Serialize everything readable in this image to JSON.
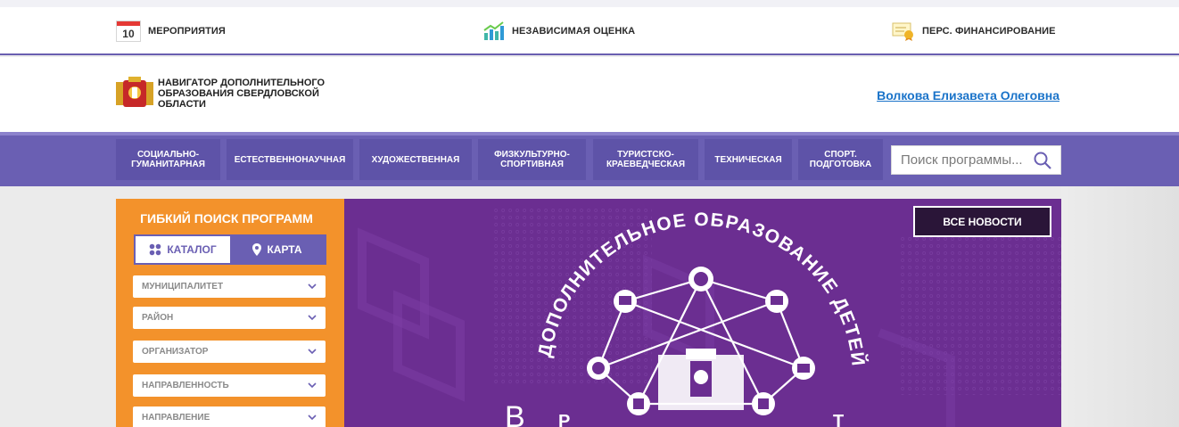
{
  "topbar": {
    "events_day": "10",
    "events_label": "МЕРОПРИЯТИЯ",
    "eval_label": "НЕЗАВИСИМАЯ ОЦЕНКА",
    "fin_label": "ПЕРС. ФИНАНСИРОВАНИЕ"
  },
  "header": {
    "brand": "НАВИГАТОР ДОПОЛНИТЕЛЬНОГО ОБРАЗОВАНИЯ СВЕРДЛОВСКОЙ ОБЛАСТИ",
    "user_name": "Волкова Елизавета Олеговна"
  },
  "nav": {
    "items": [
      "СОЦИАЛЬНО-ГУМАНИТАРНАЯ",
      "ЕСТЕСТВЕННОНАУЧНАЯ",
      "ХУДОЖЕСТВЕННАЯ",
      "ФИЗКУЛЬТУРНО-СПОРТИВНАЯ",
      "ТУРИСТСКО-КРАЕВЕДЧЕСКАЯ",
      "ТЕХНИЧЕСКАЯ",
      "СПОРТ. ПОДГОТОВКА"
    ],
    "search_placeholder": "Поиск программы..."
  },
  "filter": {
    "title": "ГИБКИЙ ПОИСК ПРОГРАММ",
    "mode_catalog": "КАТАЛОГ",
    "mode_map": "КАРТА",
    "selects": [
      "МУНИЦИПАЛИТЕТ",
      "РАЙОН",
      "ОРГАНИЗАТОР",
      "НАПРАВЛЕННОСТЬ",
      "НАПРАВЛЕНИЕ"
    ]
  },
  "banner": {
    "arc_text": "ДОПОЛНИТЕЛЬНОЕ ОБРАЗОВАНИЕ ДЕТЕЙ",
    "bottom_left_glyph": "Р",
    "bottom_right_glyph": "Т",
    "cut_text": "В",
    "news_button": "ВСЕ НОВОСТИ"
  },
  "colors": {
    "brand_purple": "#6a5fb3",
    "filter_orange": "#f3922b",
    "banner_purple": "#6b2e91",
    "link_blue": "#1a73c9"
  }
}
